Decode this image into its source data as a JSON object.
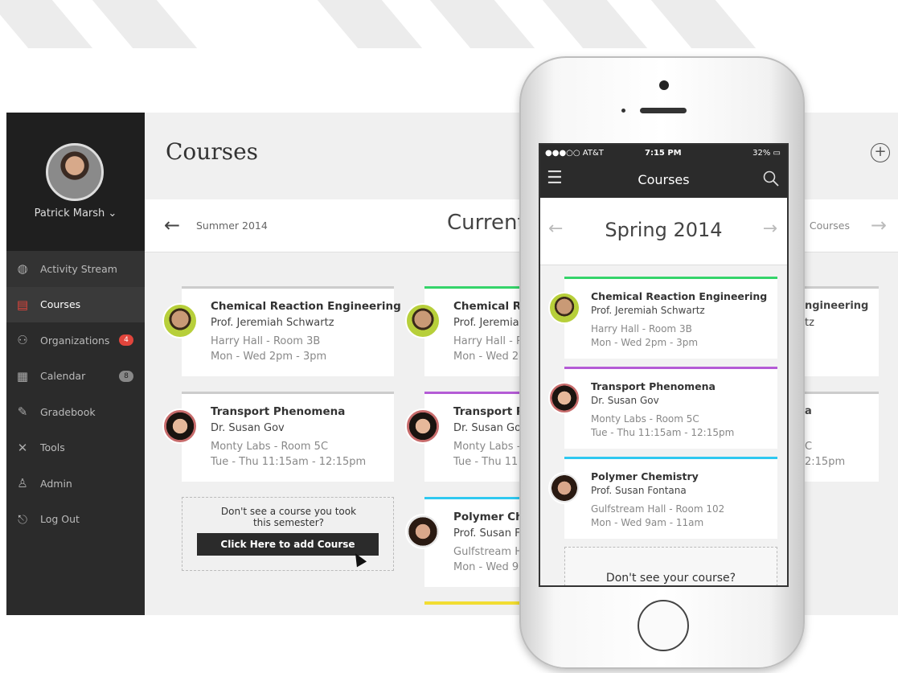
{
  "profile": {
    "name": "Patrick Marsh"
  },
  "nav": [
    {
      "label": "Activity Stream",
      "icon": "globe-icon"
    },
    {
      "label": "Courses",
      "icon": "courses-icon"
    },
    {
      "label": "Organizations",
      "icon": "organizations-icon",
      "badge": "4"
    },
    {
      "label": "Calendar",
      "icon": "calendar-icon",
      "badge": "8"
    },
    {
      "label": "Gradebook",
      "icon": "gradebook-icon"
    },
    {
      "label": "Tools",
      "icon": "tools-icon"
    },
    {
      "label": "Admin",
      "icon": "admin-icon"
    },
    {
      "label": "Log Out",
      "icon": "logout-icon"
    }
  ],
  "header": {
    "title": "Courses"
  },
  "terms": {
    "previous": "Summer 2014",
    "current": "Current",
    "next": "Courses"
  },
  "courses": [
    {
      "title": "Chemical Reaction Engineering",
      "professor": "Prof. Jeremiah Schwartz",
      "room": "Harry Hall - Room 3B",
      "time": "Mon - Wed 2pm - 3pm",
      "color": "#35d46a"
    },
    {
      "title": "Transport Phenomena",
      "professor": "Dr. Susan Gov",
      "room": "Monty Labs - Room 5C",
      "time": "Tue - Thu 11:15am - 12:15pm",
      "color": "#b45bd6"
    },
    {
      "title": "Polymer Chemistry",
      "professor": "Prof. Susan Fontana",
      "room": "Gulfstream Hall - Room 102",
      "time": "Mon - Wed 9am - 11am",
      "color": "#2fc8f0"
    }
  ],
  "col2": [
    {
      "title": "Chemical Re",
      "professor": "Prof. Jeremia",
      "room": "Harry Hall - R",
      "time": "Mon - Wed 2"
    },
    {
      "title": "Transport Ph",
      "professor": "Dr. Susan Go",
      "room": "Monty Labs -",
      "time": "Tue - Thu 11"
    },
    {
      "title": "Polymer Che",
      "professor": "Prof. Susan F",
      "room": "Gulfstream H",
      "time": "Mon - Wed 9"
    }
  ],
  "col4": [
    "ngineering",
    "tz",
    "a",
    "C",
    "2:15pm"
  ],
  "add_course": {
    "prompt_line1": "Don't see a course you took",
    "prompt_line2": "this semester?",
    "button": "Click Here to add Course"
  },
  "phone": {
    "carrier": "●●●○○ AT&T",
    "time": "7:15 PM",
    "battery": "32%",
    "app_title": "Courses",
    "term": "Spring 2014",
    "add_prompt": "Don't see your course?"
  },
  "colors": {
    "sidebar": "#2b2b2b",
    "accent": "#e1453c",
    "yellow_stripe": "#f2dd32"
  }
}
